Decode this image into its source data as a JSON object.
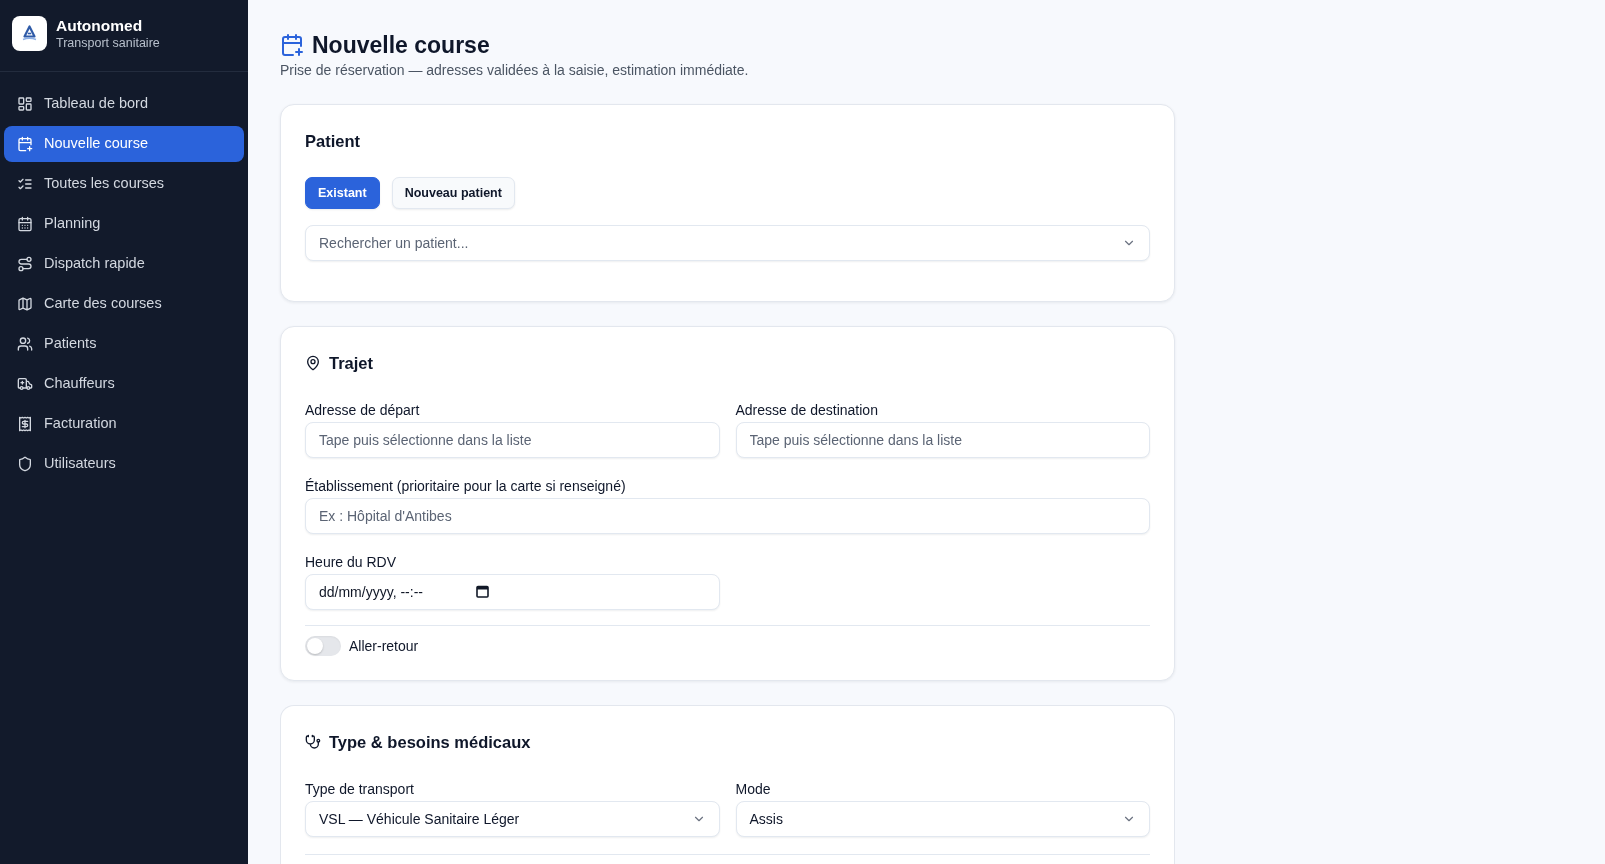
{
  "sidebar": {
    "brand": {
      "name": "Autonomed",
      "tagline": "Transport sanitaire"
    },
    "items": [
      {
        "label": "Tableau de bord",
        "selected": false
      },
      {
        "label": "Nouvelle course",
        "selected": true
      },
      {
        "label": "Toutes les courses",
        "selected": false
      },
      {
        "label": "Planning",
        "selected": false
      },
      {
        "label": "Dispatch rapide",
        "selected": false
      },
      {
        "label": "Carte des courses",
        "selected": false
      },
      {
        "label": "Patients",
        "selected": false
      },
      {
        "label": "Chauffeurs",
        "selected": false
      },
      {
        "label": "Facturation",
        "selected": false
      },
      {
        "label": "Utilisateurs",
        "selected": false
      }
    ]
  },
  "header": {
    "title": "Nouvelle course",
    "subtitle": "Prise de réservation — adresses validées à la saisie, estimation immédiate."
  },
  "patient_card": {
    "title": "Patient",
    "modes": [
      {
        "label": "Existant",
        "selected": true
      },
      {
        "label": "Nouveau patient",
        "selected": false
      }
    ],
    "search": {
      "placeholder": "Rechercher un patient..."
    }
  },
  "trip_card": {
    "title": "Trajet",
    "departure": {
      "label": "Adresse de départ",
      "placeholder": "Tape puis sélectionne dans la liste"
    },
    "destination": {
      "label": "Adresse de destination",
      "placeholder": "Tape puis sélectionne dans la liste"
    },
    "facility": {
      "label": "Établissement (prioritaire pour la carte si renseigné)",
      "placeholder": "Ex : Hôpital d'Antibes"
    },
    "appointment": {
      "label": "Heure du RDV",
      "placeholder": "dd/mm/yyyy, --:--"
    },
    "round_trip": {
      "label": "Aller-retour",
      "on": false
    }
  },
  "medical_card": {
    "title": "Type & besoins médicaux",
    "transport_type": {
      "label": "Type de transport",
      "value": "VSL — Véhicule Sanitaire Léger"
    },
    "mode": {
      "label": "Mode",
      "value": "Assis"
    }
  }
}
